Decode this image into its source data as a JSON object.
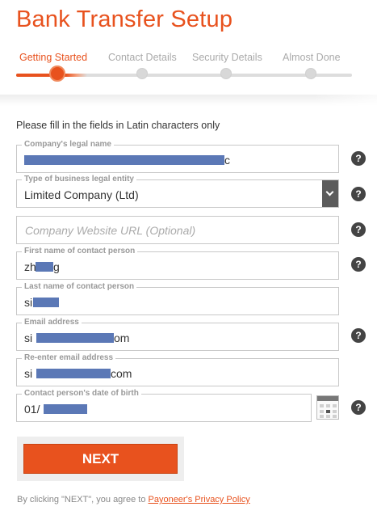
{
  "page": {
    "title": "Bank Transfer Setup"
  },
  "steps": [
    {
      "label": "Getting Started",
      "active": true
    },
    {
      "label": "Contact Details",
      "active": false
    },
    {
      "label": "Security Details",
      "active": false
    },
    {
      "label": "Almost Done",
      "active": false
    }
  ],
  "form": {
    "intro": "Please fill in the fields in Latin characters only",
    "company_name": {
      "label": "Company's legal name",
      "value": "c"
    },
    "business_type": {
      "label": "Type of business legal entity",
      "value": "Limited Company (Ltd)"
    },
    "website": {
      "placeholder": "Company Website URL (Optional)",
      "value": ""
    },
    "first_name": {
      "label": "First name of contact person",
      "value_start": "zh",
      "value_end": "g"
    },
    "last_name": {
      "label": "Last name of contact person",
      "value": "si"
    },
    "email": {
      "label": "Email address",
      "value_start": "si",
      "value_end": "om"
    },
    "email_confirm": {
      "label": "Re-enter email address",
      "value_start": "si",
      "value_end": "com"
    },
    "dob": {
      "label": "Contact person's date of birth",
      "value": "01/"
    }
  },
  "help_icon": "?",
  "actions": {
    "next_label": "NEXT",
    "agree_prefix": "By clicking \"NEXT\", you agree to ",
    "privacy_link": "Payoneer's Privacy Policy"
  },
  "colors": {
    "accent": "#e8521e",
    "redaction": "#5b78b6",
    "help_icon_bg": "#444444"
  },
  "icons": [
    "question-mark-icon",
    "chevron-down-icon",
    "calendar-icon"
  ]
}
